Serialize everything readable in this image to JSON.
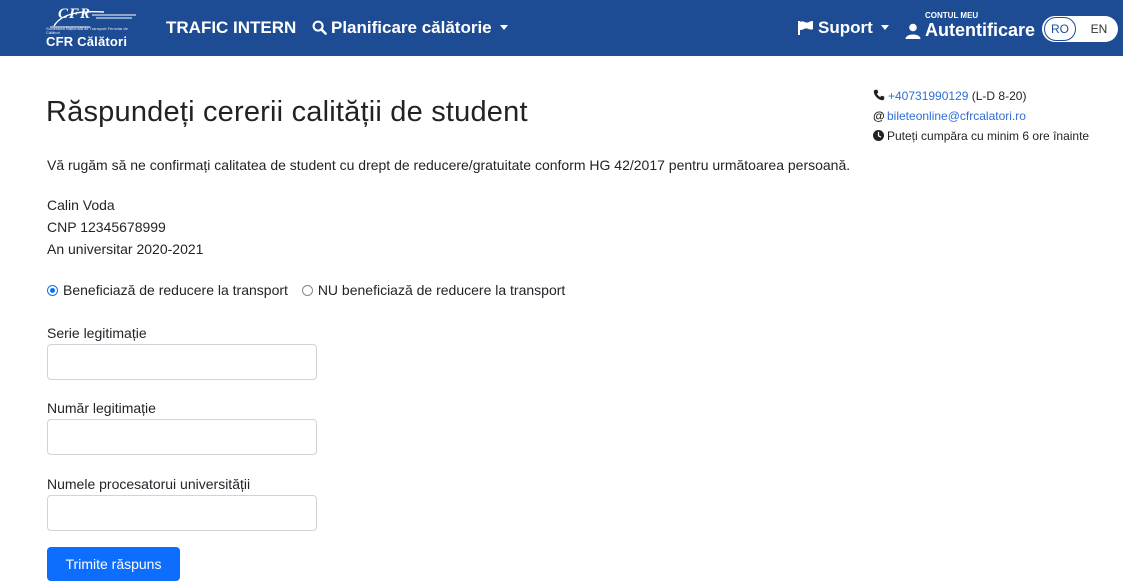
{
  "navbar": {
    "logo": {
      "mark": "CFR",
      "tagline": "Societatea Națională de Transport Feroviar de Călători",
      "name": "CFR Călători"
    },
    "trafic_intern": "TRAFIC INTERN",
    "planificare": "Planificare călătorie",
    "suport": "Suport",
    "account_small": "CONTUL MEU",
    "account_main": "Autentificare",
    "lang_ro": "RO",
    "lang_en": "EN",
    "colors": {
      "bar": "#1d4c94",
      "text": "#ffffff"
    },
    "icons": [
      "search-icon",
      "flag-icon",
      "user-icon"
    ]
  },
  "contact": {
    "phone": "+40731990129",
    "phone_hours": "(L-D 8-20)",
    "email": "bileteonline@cfrcalatori.ro",
    "notice": "Puteți cumpăra cu minim 6 ore înainte",
    "icons": [
      "phone-icon",
      "at-icon",
      "clock-icon"
    ]
  },
  "page": {
    "title": "Răspundeți cererii calității de student",
    "intro": "Vă rugăm să ne confirmați calitatea de student cu drept de reducere/gratuitate conform HG 42/2017 pentru următoarea persoană."
  },
  "student": {
    "name": "Calin Voda",
    "cnp": "CNP 12345678999",
    "year": "An universitar 2020-2021"
  },
  "form": {
    "radio_yes": "Beneficiază de reducere la transport",
    "radio_no": "NU beneficiază de reducere la transport",
    "selected": "yes",
    "serie_label": "Serie legitimație",
    "serie_value": "",
    "numar_label": "Număr legitimație",
    "numar_value": "",
    "procesator_label": "Numele procesatorui universității",
    "procesator_value": "",
    "submit": "Trimite răspuns",
    "accent": "#0d6efd"
  }
}
